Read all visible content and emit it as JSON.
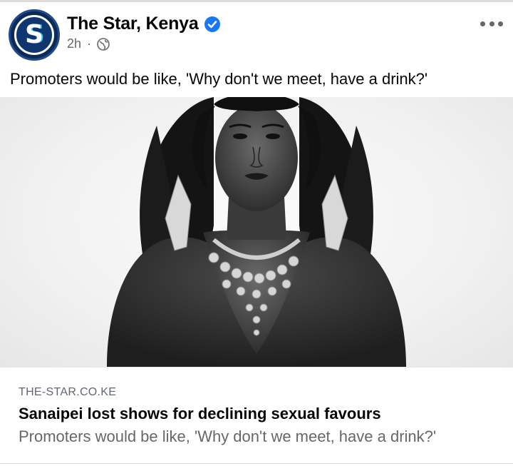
{
  "post": {
    "page_name": "The Star, Kenya",
    "timestamp": "2h",
    "meta_separator": "·",
    "avatar_letter": "S",
    "verified_icon": "verified-badge-icon",
    "privacy_icon": "globe-icon",
    "more_icon": "more-options-icon",
    "text": "Promoters would be like, 'Why don't we meet, have a drink?'"
  },
  "link_preview": {
    "domain": "THE-STAR.CO.KE",
    "title": "Sanaipei lost shows for declining sexual favours",
    "description": "Promoters would be like, 'Why don't we meet, have a drink?'"
  },
  "colors": {
    "verified_blue": "#1877f2",
    "avatar_navy": "#0e376f",
    "avatar_accent": "#3fc7f5",
    "secondary_text": "#65676b"
  }
}
